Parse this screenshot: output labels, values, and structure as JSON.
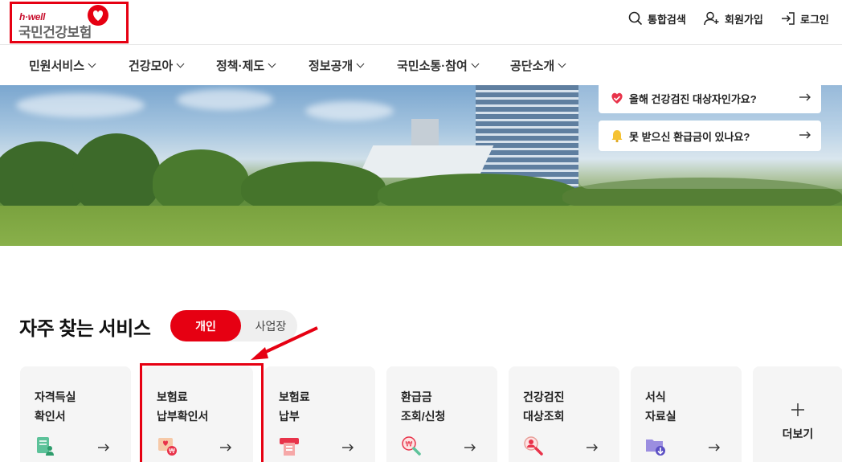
{
  "header": {
    "logo_tagline": "h·well",
    "logo_name": "국민건강보험",
    "utilities": [
      {
        "label": "통합검색",
        "icon": "search-icon"
      },
      {
        "label": "회원가입",
        "icon": "add-user-icon"
      },
      {
        "label": "로그인",
        "icon": "login-icon"
      }
    ]
  },
  "nav": {
    "items": [
      {
        "label": "민원서비스"
      },
      {
        "label": "건강모아"
      },
      {
        "label": "정책·제도"
      },
      {
        "label": "정보공개"
      },
      {
        "label": "국민소통·참여"
      },
      {
        "label": "공단소개"
      }
    ]
  },
  "hero": {
    "quick_links": [
      {
        "label": "올해 건강검진 대상자인가요?",
        "icon": "heart-check-icon"
      },
      {
        "label": "못 받으신 환급금이 있나요?",
        "icon": "bell-icon"
      }
    ]
  },
  "services": {
    "title": "자주 찾는 서비스",
    "tabs": [
      {
        "label": "개인",
        "active": true
      },
      {
        "label": "사업장",
        "active": false
      }
    ],
    "cards": [
      {
        "line1": "자격득실",
        "line2": "확인서",
        "icon": "document-person-icon"
      },
      {
        "line1": "보험료",
        "line2": "납부확인서",
        "icon": "payment-receipt-icon"
      },
      {
        "line1": "보험료",
        "line2": "납부",
        "icon": "card-payment-icon"
      },
      {
        "line1": "환급금",
        "line2": "조회/신청",
        "icon": "refund-search-icon"
      },
      {
        "line1": "건강검진",
        "line2": "대상조회",
        "icon": "person-search-icon"
      },
      {
        "line1": "서식",
        "line2": "자료실",
        "icon": "folder-download-icon"
      }
    ],
    "more_label": "더보기"
  },
  "colors": {
    "brand_red": "#e60012",
    "annotation_red": "#e60012"
  }
}
